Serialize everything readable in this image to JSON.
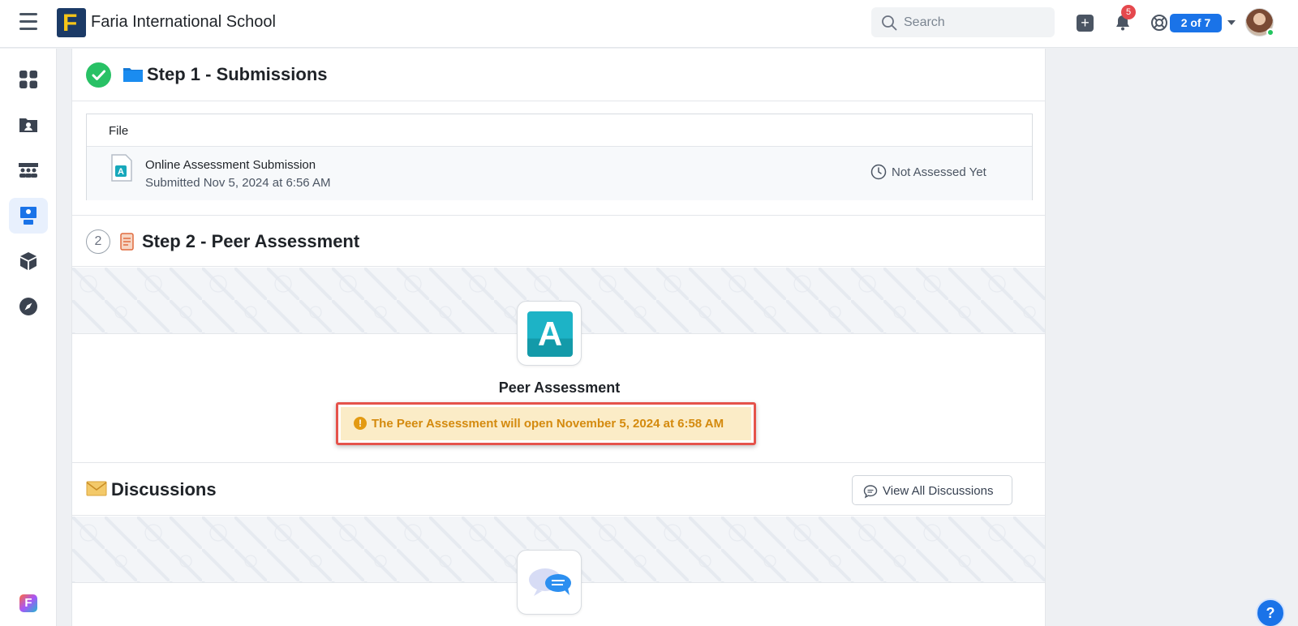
{
  "header": {
    "school_name": "Faria International School",
    "logo_letter": "F",
    "search_placeholder": "Search",
    "notification_count": "5",
    "pager_label": "2 of 7"
  },
  "sidebar": {
    "items": [
      {
        "icon": "dashboard-grid-icon",
        "active": false
      },
      {
        "icon": "profile-folder-icon",
        "active": false
      },
      {
        "icon": "classes-icon",
        "active": false
      },
      {
        "icon": "teaching-board-icon",
        "active": true
      },
      {
        "icon": "package-box-icon",
        "active": false
      },
      {
        "icon": "compass-icon",
        "active": false
      }
    ],
    "app_logo_letter": "F"
  },
  "step1": {
    "title": "Step 1 - Submissions",
    "table_header": "File",
    "file": {
      "name": "Online Assessment Submission",
      "submitted": "Submitted Nov 5, 2024 at 6:56 AM",
      "status": "Not Assessed Yet"
    }
  },
  "step2": {
    "number": "2",
    "title": "Step 2 - Peer Assessment",
    "card_letter": "A",
    "card_title": "Peer Assessment",
    "notice": "The Peer Assessment will open November 5, 2024 at 6:58 AM",
    "notice_icon_glyph": "!"
  },
  "discussions": {
    "title": "Discussions",
    "view_all_label": "View All Discussions"
  },
  "help_glyph": "?",
  "colors": {
    "accent": "#1a73e8",
    "success": "#28c165",
    "warning_bg": "#fbecc7",
    "warning_text": "#d48a0e",
    "highlight_outline": "#e5534b"
  }
}
